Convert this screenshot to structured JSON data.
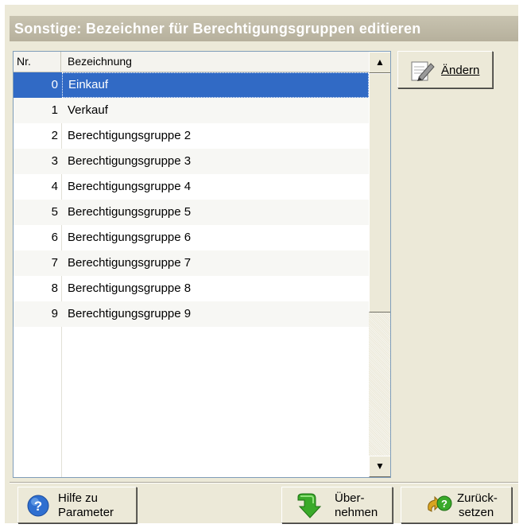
{
  "window": {
    "title": "Sonstige: Bezeichner für Berechtigungsgruppen editieren"
  },
  "list": {
    "columns": [
      "Nr.",
      "Bezeichnung"
    ],
    "rows": [
      {
        "nr": "0",
        "name": "Einkauf",
        "selected": true
      },
      {
        "nr": "1",
        "name": "Verkauf",
        "selected": false
      },
      {
        "nr": "2",
        "name": "Berechtigungsgruppe 2",
        "selected": false
      },
      {
        "nr": "3",
        "name": "Berechtigungsgruppe 3",
        "selected": false
      },
      {
        "nr": "4",
        "name": "Berechtigungsgruppe 4",
        "selected": false
      },
      {
        "nr": "5",
        "name": "Berechtigungsgruppe 5",
        "selected": false
      },
      {
        "nr": "6",
        "name": "Berechtigungsgruppe 6",
        "selected": false
      },
      {
        "nr": "7",
        "name": "Berechtigungsgruppe 7",
        "selected": false
      },
      {
        "nr": "8",
        "name": "Berechtigungsgruppe 8",
        "selected": false
      },
      {
        "nr": "9",
        "name": "Berechtigungsgruppe 9",
        "selected": false
      }
    ],
    "scroll_up": "▲",
    "scroll_down": "▼"
  },
  "buttons": {
    "edit": {
      "label": "Ändern",
      "icon": "edit-pencil-icon"
    },
    "help": {
      "line1": "Hilfe zu",
      "line2": "Parameter",
      "icon": "help-question-icon"
    },
    "apply": {
      "line1": "Über-",
      "line2": "nehmen",
      "icon": "green-arrow-down-icon"
    },
    "reset": {
      "line1": "Zurück-",
      "line2": "setzen",
      "icon": "reset-question-icon"
    }
  },
  "colors": {
    "selection": "#316ac5",
    "panel": "#ece9d8",
    "title_bar": "#b6b09c"
  }
}
